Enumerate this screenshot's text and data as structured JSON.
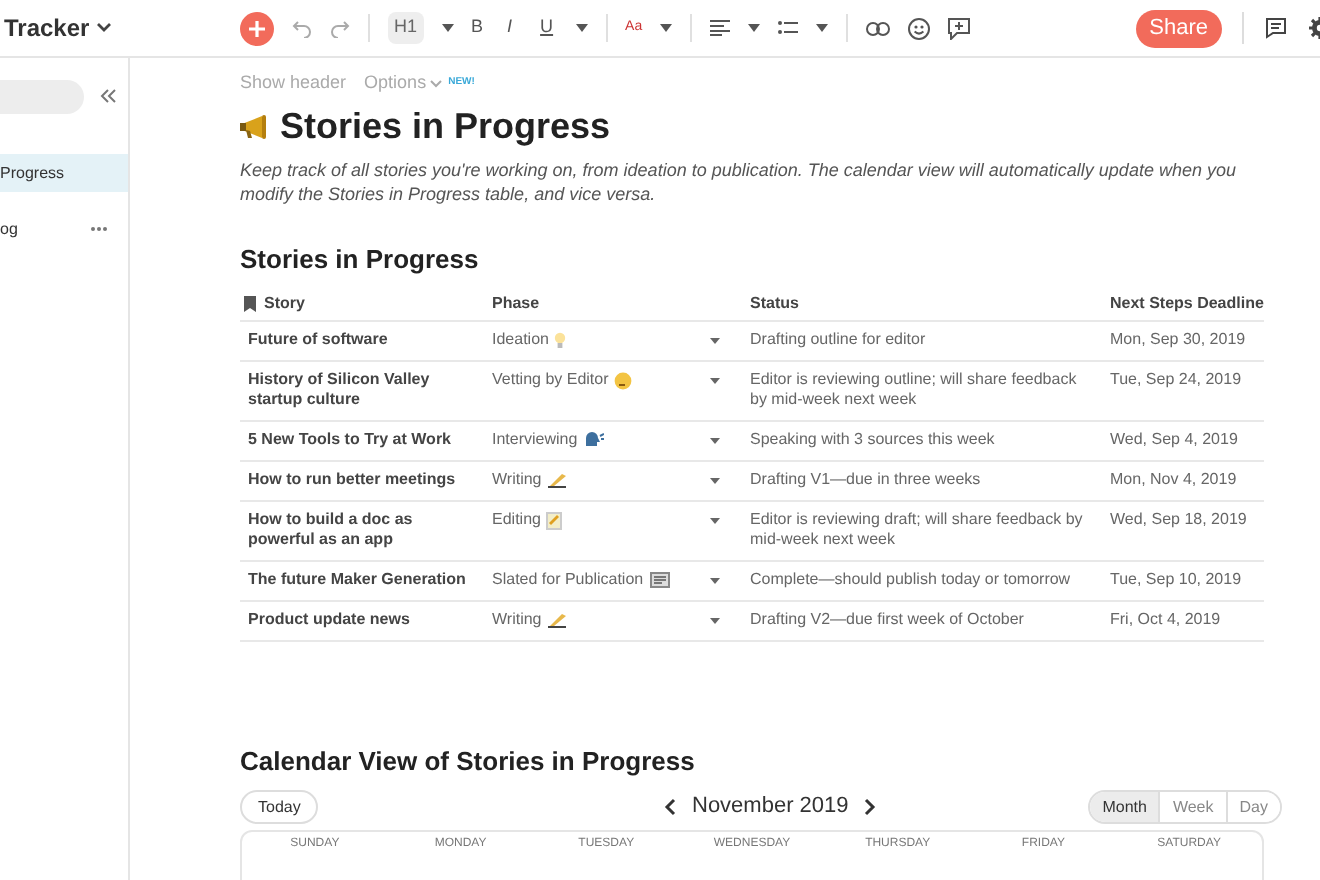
{
  "doc_title": "Tracker",
  "toolbar": {
    "heading_button": "H1",
    "bold": "B",
    "italic": "I",
    "underline": "U",
    "text_color": "Aa",
    "share": "Share"
  },
  "sidebar": {
    "items": [
      {
        "label": "Progress",
        "selected": true,
        "more": false
      },
      {
        "label": "og",
        "selected": false,
        "more": true
      }
    ]
  },
  "page": {
    "show_header": "Show header",
    "options": "Options",
    "options_badge": "NEW!",
    "title": "Stories in Progress",
    "intro": "Keep track of all stories you're working on, from ideation to publication. The calendar view will automatically update when you modify the Stories in Progress table, and vice versa."
  },
  "table": {
    "title": "Stories in Progress",
    "columns": [
      "Story",
      "Phase",
      "Status",
      "Next Steps Deadline"
    ],
    "rows": [
      {
        "story": "Future of software",
        "phase": "Ideation",
        "kind": "bulb",
        "status": "Drafting outline for editor",
        "deadline": "Mon, Sep 30, 2019"
      },
      {
        "story": "History of Silicon Valley startup culture",
        "phase": "Vetting by Editor",
        "kind": "thinking",
        "status": "Editor is reviewing outline; will share feedback by mid-week next week",
        "deadline": "Tue, Sep 24, 2019"
      },
      {
        "story": "5 New Tools to Try at Work",
        "phase": "Interviewing",
        "kind": "speaking",
        "status": "Speaking with 3 sources this week",
        "deadline": "Wed, Sep 4, 2019"
      },
      {
        "story": "How to run better meetings",
        "phase": "Writing",
        "kind": "writing",
        "status": "Drafting V1—due in three weeks",
        "deadline": "Mon, Nov 4, 2019"
      },
      {
        "story": "How to build a doc as powerful as an app",
        "phase": "Editing",
        "kind": "memo",
        "status": "Editor is reviewing draft; will share feedback by mid-week next week",
        "deadline": "Wed, Sep 18, 2019"
      },
      {
        "story": "The future Maker Generation",
        "phase": "Slated for Publication",
        "kind": "newspaper",
        "status": "Complete—should publish today or tomorrow",
        "deadline": "Tue, Sep 10, 2019"
      },
      {
        "story": "Product update news",
        "phase": "Writing",
        "kind": "writing",
        "status": "Drafting V2—due first week of October",
        "deadline": "Fri, Oct 4, 2019"
      }
    ]
  },
  "calendar": {
    "title": "Calendar View of Stories in Progress",
    "today": "Today",
    "month": "November 2019",
    "views": [
      {
        "label": "Month",
        "selected": true
      },
      {
        "label": "Week",
        "selected": false
      },
      {
        "label": "Day",
        "selected": false
      }
    ],
    "weekdays": [
      "SUNDAY",
      "MONDAY",
      "TUESDAY",
      "WEDNESDAY",
      "THURSDAY",
      "FRIDAY",
      "SATURDAY"
    ]
  }
}
